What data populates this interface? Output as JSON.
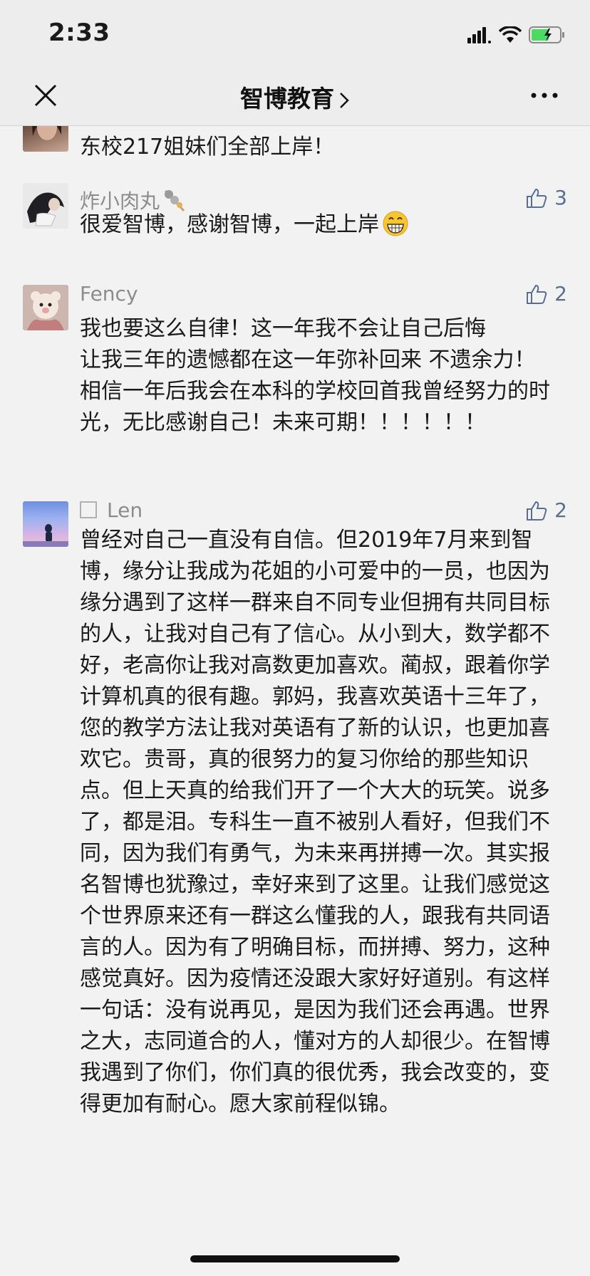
{
  "status_bar": {
    "time": "2:33"
  },
  "nav": {
    "title": "智博教育"
  },
  "comments": [
    {
      "name": "",
      "text": "东校217姐妹们全部上岸！",
      "likes": ""
    },
    {
      "name": "炸小肉丸",
      "text": "很爱智博，感谢智博，一起上岸",
      "likes": "3"
    },
    {
      "name": "Fency",
      "text": "我也要这么自律！这一年我不会让自己后悔\n让我三年的遗憾都在这一年弥补回来  不遗余力！\n相信一年后我会在本科的学校回首我曾经努力的时光，无比感谢自己！未来可期！！！！！！",
      "likes": "2"
    },
    {
      "name": "Len",
      "text": "曾经对自己一直没有自信。但2019年7月来到智博，缘分让我成为花姐的小可爱中的一员，也因为缘分遇到了这样一群来自不同专业但拥有共同目标的人，让我对自己有了信心。从小到大，数学都不好，老高你让我对高数更加喜欢。蔺叔，跟着你学计算机真的很有趣。郭妈，我喜欢英语十三年了，您的教学方法让我对英语有了新的认识，也更加喜欢它。贵哥，真的很努力的复习你给的那些知识点。但上天真的给我们开了一个大大的玩笑。说多了，都是泪。专科生一直不被别人看好，但我们不同，因为我们有勇气，为未来再拼搏一次。其实报名智博也犹豫过，幸好来到了这里。让我们感觉这个世界原来还有一群这么懂我的人，跟我有共同语言的人。因为有了明确目标，而拼搏、努力，这种感觉真好。因为疫情还没跟大家好好道别。有这样一句话：没有说再见，是因为我们还会再遇。世界之大，志同道合的人，懂对方的人却很少。在智博我遇到了你们，你们真的很优秀，我会改变的，变得更加有耐心。愿大家前程似锦。",
      "likes": "2"
    }
  ],
  "icons": {
    "close": "close-icon",
    "more": "more-icon",
    "like": "thumbs-up-icon",
    "emoji": "grinning-emoji-icon",
    "food_emoji": "skewer-icon"
  },
  "colors": {
    "like": "#5a6e94",
    "name": "#8c8c8c",
    "background": "#f2f2f2"
  }
}
